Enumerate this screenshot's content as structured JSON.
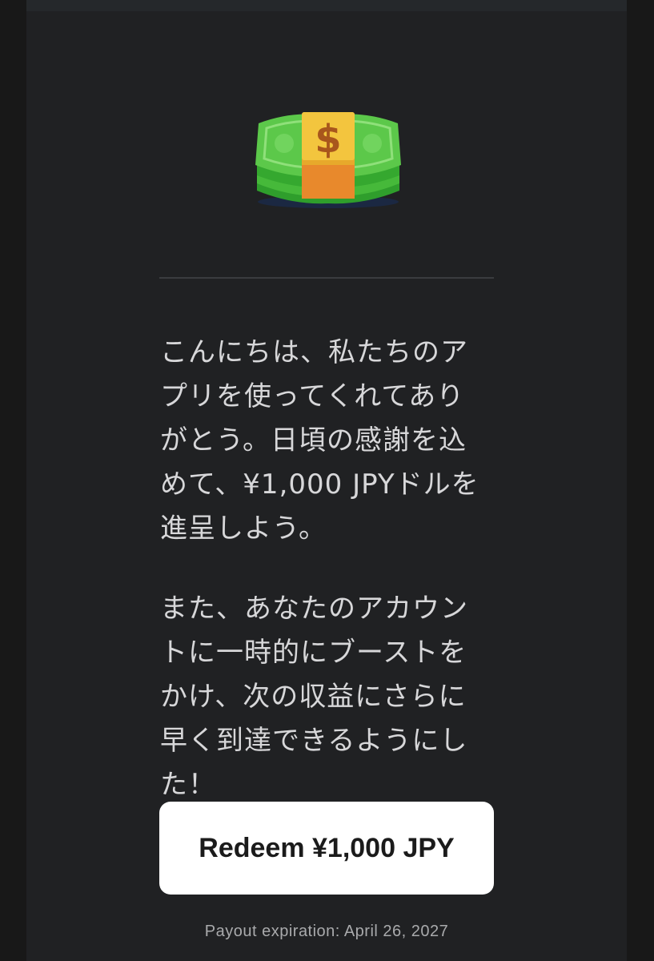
{
  "email": {
    "hero_icon": "money-bag-icon",
    "paragraph_1": "こんにちは、私たちのアプリを使ってくれてありがとう。日頃の感謝を込めて、¥1,000 JPYドルを進呈しよう。",
    "paragraph_2": "また、あなたのアカウントに一時的にブーストをかけ、次の収益にさらに早く到達できるようにした！",
    "redeem_button_label": "Redeem ¥1,000 JPY",
    "payout_expiration": "Payout expiration: April 26, 2027"
  },
  "colors": {
    "page_background": "#181818",
    "card_background": "#202123",
    "text": "#d7d7d9",
    "button_background": "#ffffff",
    "button_text": "#1b1b1b"
  }
}
